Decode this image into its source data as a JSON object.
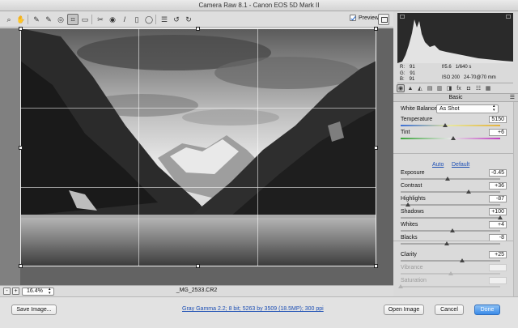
{
  "window": {
    "title": "Camera Raw 8.1  -  Canon EOS 5D Mark II"
  },
  "toolbar": {
    "tools": [
      {
        "name": "zoom-tool-icon",
        "glyph": "⌕",
        "active": false
      },
      {
        "name": "hand-tool-icon",
        "glyph": "✋",
        "active": false
      },
      {
        "name": "white-balance-tool-icon",
        "glyph": "✎",
        "active": false
      },
      {
        "name": "color-sampler-tool-icon",
        "glyph": "✎",
        "active": false
      },
      {
        "name": "targeted-adjustment-tool-icon",
        "glyph": "◎",
        "active": false
      },
      {
        "name": "crop-tool-icon",
        "glyph": "⌗",
        "active": true
      },
      {
        "name": "straighten-tool-icon",
        "glyph": "▭",
        "active": false
      },
      {
        "name": "spot-removal-tool-icon",
        "glyph": "✂",
        "active": false
      },
      {
        "name": "red-eye-removal-tool-icon",
        "glyph": "◉",
        "active": false
      },
      {
        "name": "adjustment-brush-icon",
        "glyph": "/",
        "active": false
      },
      {
        "name": "graduated-filter-icon",
        "glyph": "▯",
        "active": false
      },
      {
        "name": "radial-filter-icon",
        "glyph": "◯",
        "active": false
      },
      {
        "name": "preferences-icon",
        "glyph": "☰",
        "active": false
      },
      {
        "name": "rotate-left-icon",
        "glyph": "↺",
        "active": false
      },
      {
        "name": "rotate-right-icon",
        "glyph": "↻",
        "active": false
      }
    ],
    "preview_label": "Preview"
  },
  "status": {
    "zoom": "16.4%",
    "filename": "_MG_2533.CR2",
    "zoom_out": "-",
    "zoom_in": "+"
  },
  "info": {
    "rgb": [
      {
        "label": "R:",
        "value": "91"
      },
      {
        "label": "G:",
        "value": "91"
      },
      {
        "label": "B:",
        "value": "91"
      }
    ],
    "aperture": "f/5.6",
    "shutter": "1/640 s",
    "iso": "ISO 200",
    "lens": "24-70@70 mm"
  },
  "panel": {
    "title": "Basic",
    "tabs": [
      "◉",
      "▲",
      "◭",
      "▤",
      "▥",
      "◨",
      "fx",
      "◘",
      "☷",
      "▦"
    ],
    "white_balance_label": "White Balance:",
    "white_balance_value": "As Shot",
    "auto_label": "Auto",
    "default_label": "Default"
  },
  "sliders": [
    {
      "label": "Temperature",
      "value": "5150",
      "pos": 0.45,
      "disabled": false
    },
    {
      "label": "Tint",
      "value": "+6",
      "pos": 0.53,
      "disabled": false
    },
    {
      "label": "Exposure",
      "value": "-0.45",
      "pos": 0.47,
      "disabled": false
    },
    {
      "label": "Contrast",
      "value": "+36",
      "pos": 0.68,
      "disabled": false
    },
    {
      "label": "Highlights",
      "value": "-87",
      "pos": 0.07,
      "disabled": false
    },
    {
      "label": "Shadows",
      "value": "+100",
      "pos": 1.0,
      "disabled": false
    },
    {
      "label": "Whites",
      "value": "+4",
      "pos": 0.52,
      "disabled": false
    },
    {
      "label": "Blacks",
      "value": "-8",
      "pos": 0.46,
      "disabled": false
    },
    {
      "label": "Clarity",
      "value": "+25",
      "pos": 0.62,
      "disabled": false
    },
    {
      "label": "Vibrance",
      "value": "",
      "pos": 0.5,
      "disabled": true
    },
    {
      "label": "Saturation",
      "value": "",
      "pos": 0.0,
      "disabled": true
    }
  ],
  "bottom": {
    "save_label": "Save Image...",
    "workflow_link": "Gray Gamma 2.2; 8 bit; 5263 by 3509 (18.5MP); 300 ppi",
    "open_label": "Open Image",
    "cancel_label": "Cancel",
    "done_label": "Done"
  },
  "colors": {
    "done_blue": "#3a8be8",
    "link_blue": "#1d4fb4"
  }
}
